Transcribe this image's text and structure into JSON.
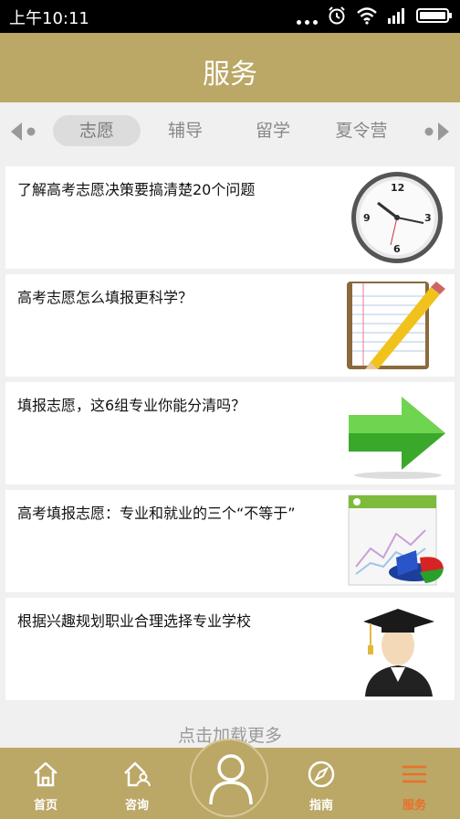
{
  "status_bar": {
    "time": "上午10:11"
  },
  "header": {
    "title": "服务"
  },
  "tabs": [
    {
      "label": "志愿",
      "active": true
    },
    {
      "label": "辅导",
      "active": false
    },
    {
      "label": "留学",
      "active": false
    },
    {
      "label": "夏令营",
      "active": false
    }
  ],
  "articles": [
    {
      "title": "了解高考志愿决策要搞清楚20个问题",
      "thumb_icon": "clock-icon"
    },
    {
      "title": "高考志愿怎么填报更科学？",
      "thumb_icon": "notepad-pencil-icon"
    },
    {
      "title": "填报志愿，这6组专业你能分清吗？",
      "thumb_icon": "green-arrow-icon"
    },
    {
      "title": "高考填报志愿：专业和就业的三个“不等于”",
      "thumb_icon": "chart-icon"
    },
    {
      "title": "根据兴趣规划职业合理选择专业学校",
      "thumb_icon": "graduate-icon"
    }
  ],
  "load_more": "点击加载更多",
  "bottom_nav": {
    "home": "首页",
    "consult": "咨询",
    "guide": "指南",
    "service": "服务",
    "active_color": "#e8702a"
  },
  "colors": {
    "brand": "#bba766",
    "background": "#f0f0f0"
  }
}
